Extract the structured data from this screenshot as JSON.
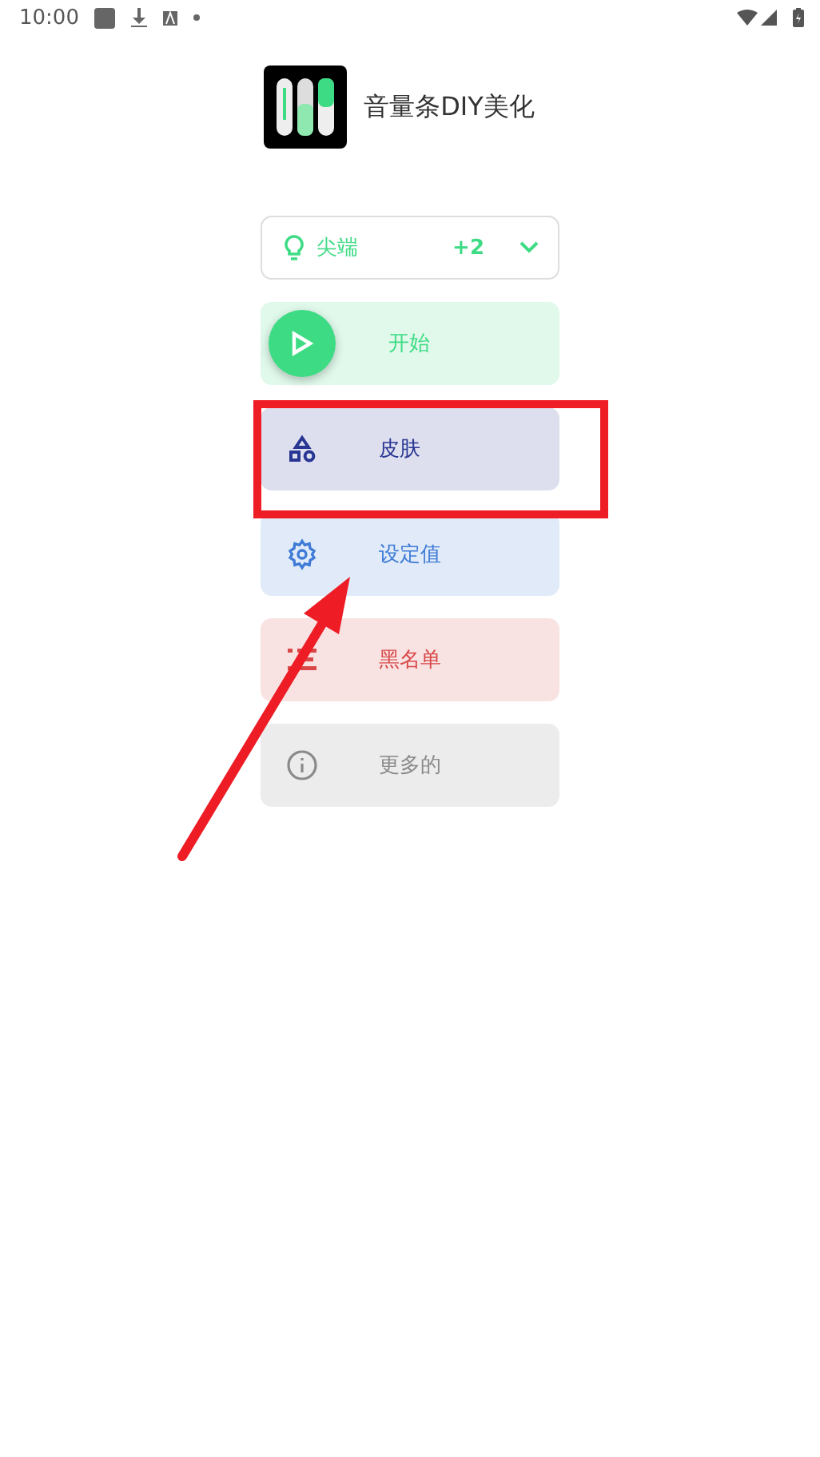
{
  "status_bar": {
    "time": "10:00"
  },
  "app": {
    "title": "音量条DIY美化"
  },
  "style_picker": {
    "label": "尖端",
    "extra": "+2"
  },
  "menu": [
    {
      "kind": "start",
      "label": "开始",
      "color": "#3ddc84"
    },
    {
      "kind": "skin",
      "label": "皮肤",
      "color": "#283593"
    },
    {
      "kind": "settings",
      "label": "设定值",
      "color": "#3f7bd6"
    },
    {
      "kind": "blacklist",
      "label": "黑名单",
      "color": "#d84848"
    },
    {
      "kind": "more",
      "label": "更多的",
      "color": "#8a8a8a"
    }
  ]
}
